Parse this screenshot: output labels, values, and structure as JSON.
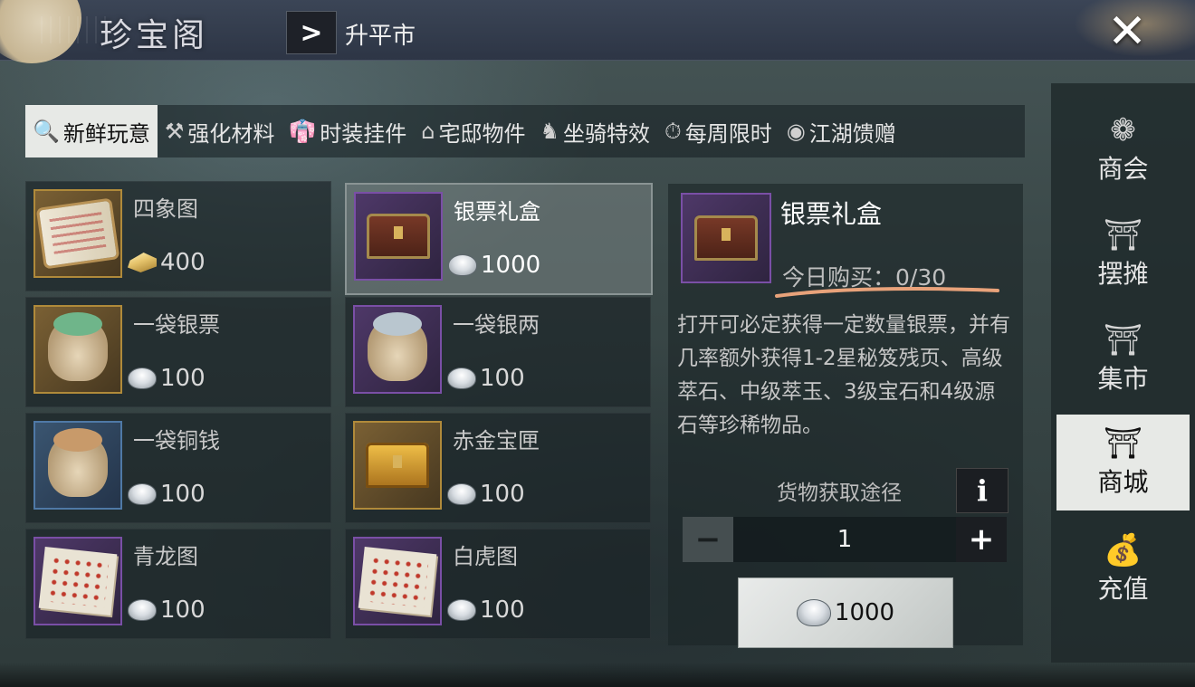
{
  "header": {
    "title": "珍宝阁",
    "breadcrumb_arrow": ">",
    "location": "升平市",
    "close_label": "✕"
  },
  "tabs": [
    {
      "icon": "magnifier-icon",
      "glyph": "🔍",
      "label": "新鲜玩意",
      "active": true
    },
    {
      "icon": "enhance-material-icon",
      "glyph": "⚒",
      "label": "强化材料"
    },
    {
      "icon": "costume-icon",
      "glyph": "👘",
      "label": "时装挂件"
    },
    {
      "icon": "house-icon",
      "glyph": "⌂",
      "label": "宅邸物件"
    },
    {
      "icon": "horse-icon",
      "glyph": "♞",
      "label": "坐骑特效"
    },
    {
      "icon": "stopwatch-icon",
      "glyph": "⏱",
      "label": "每周限时"
    },
    {
      "icon": "gift-icon",
      "glyph": "◉",
      "label": "江湖馈赠"
    }
  ],
  "items": [
    {
      "name": "四象图",
      "price": "400",
      "currency": "gold-ingot-icon",
      "frame": "gold",
      "art": "scroll"
    },
    {
      "name": "银票礼盒",
      "price": "1000",
      "currency": "silver-ingot-icon",
      "frame": "purple",
      "art": "chest",
      "selected": true
    },
    {
      "name": "一袋银票",
      "price": "100",
      "currency": "silver-ingot-icon",
      "frame": "gold",
      "art": "bag-green"
    },
    {
      "name": "一袋银两",
      "price": "100",
      "currency": "silver-ingot-icon",
      "frame": "purple",
      "art": "bag-silver"
    },
    {
      "name": "一袋铜钱",
      "price": "100",
      "currency": "silver-ingot-icon",
      "frame": "blue",
      "art": "bag-copper"
    },
    {
      "name": "赤金宝匣",
      "price": "100",
      "currency": "silver-ingot-icon",
      "frame": "gold",
      "art": "chest-gold"
    },
    {
      "name": "青龙图",
      "price": "100",
      "currency": "silver-ingot-icon",
      "frame": "purple",
      "art": "map"
    },
    {
      "name": "白虎图",
      "price": "100",
      "currency": "silver-ingot-icon",
      "frame": "purple",
      "art": "map"
    }
  ],
  "detail": {
    "name": "银票礼盒",
    "daily_limit": "今日购买：0/30",
    "description": "打开可必定获得一定数量银票，并有几率额外获得1-2星秘笈残页、高级萃石、中级萃玉、3级宝石和4级源石等珍稀物品。",
    "source_label": "货物获取途径",
    "info_label": "i",
    "minus_label": "−",
    "plus_label": "+",
    "quantity": "1",
    "total_price": "1000",
    "underline_color": "#e8a27a"
  },
  "sidenav": [
    {
      "icon": "guild-icon",
      "glyph": "❁",
      "label": "商会"
    },
    {
      "icon": "stall-icon",
      "glyph": "⛩",
      "label": "摆摊"
    },
    {
      "icon": "market-icon",
      "glyph": "⛩",
      "label": "集市"
    },
    {
      "icon": "mall-icon",
      "glyph": "⛩",
      "label": "商城",
      "active": true
    },
    {
      "icon": "recharge-icon",
      "glyph": "💰",
      "label": "充值"
    }
  ]
}
